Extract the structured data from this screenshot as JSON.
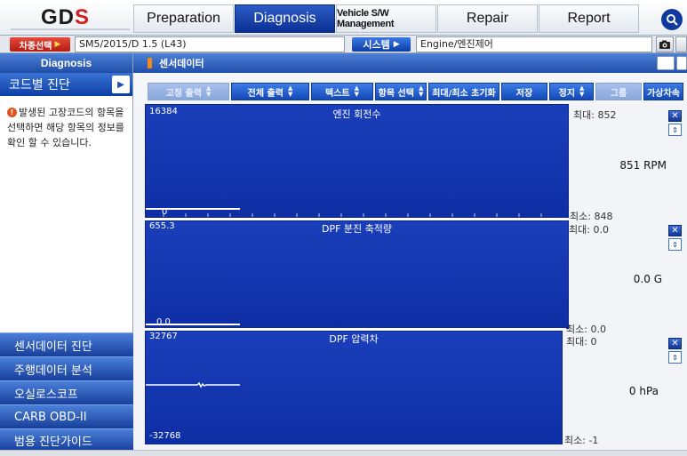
{
  "header": {
    "logo_main": "GD",
    "logo_accent": "S",
    "tabs": [
      {
        "label": "Preparation"
      },
      {
        "label": "Diagnosis"
      },
      {
        "label": "Vehicle S/W Management"
      },
      {
        "label": "Repair"
      },
      {
        "label": "Report"
      }
    ]
  },
  "vehicle_bar": {
    "vehicle_button": "차종선택",
    "vehicle_value": "SM5/2015/D 1.5 (L43)",
    "system_button": "시스템",
    "system_value": "Engine/엔진제어"
  },
  "sidebar": {
    "header": "Diagnosis",
    "title": "코드별 진단",
    "description": "발생된 고장코드의 항목을 선택하면 해당 항목의 정보를 확인 할 수 있습니다.",
    "menu": [
      {
        "label": "센서데이터 진단"
      },
      {
        "label": "주행데이터 분석"
      },
      {
        "label": "오실로스코프"
      },
      {
        "label": "CARB OBD-II"
      },
      {
        "label": "범용 진단가이드"
      }
    ]
  },
  "main": {
    "title": "센서데이터",
    "toolbar": [
      {
        "label": "고정 출력"
      },
      {
        "label": "전체 출력"
      },
      {
        "label": "텍스트"
      },
      {
        "label": "항목 선택"
      },
      {
        "label": "최대/최소 초기화"
      },
      {
        "label": "저장"
      },
      {
        "label": "정지"
      },
      {
        "label": "그룹"
      },
      {
        "label": "가상차속"
      }
    ],
    "sensors": [
      {
        "name": "엔진 회전수",
        "scale_top": "16384",
        "scale_bottom": "0",
        "max": "최대: 852",
        "value": "851 RPM",
        "min": "최소: 848"
      },
      {
        "name": "DPF 분진 축적량",
        "scale_top": "655.3",
        "scale_bottom": "0.0",
        "max": "최대: 0.0",
        "value": "0.0 G",
        "min": "최소: 0.0"
      },
      {
        "name": "DPF 압력차",
        "scale_top": "32767",
        "scale_bottom": "-32768",
        "max": "최대: 0",
        "value": "0 hPa",
        "min": "최소: -1"
      }
    ]
  }
}
